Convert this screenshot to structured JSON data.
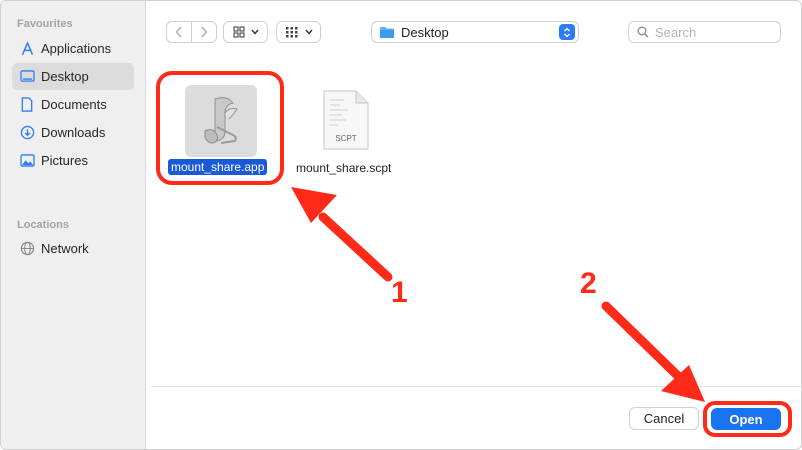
{
  "sidebar": {
    "favourites_title": "Favourites",
    "items": [
      {
        "label": "Applications",
        "icon": "applications-icon"
      },
      {
        "label": "Desktop",
        "icon": "desktop-icon"
      },
      {
        "label": "Documents",
        "icon": "documents-icon"
      },
      {
        "label": "Downloads",
        "icon": "downloads-icon"
      },
      {
        "label": "Pictures",
        "icon": "pictures-icon"
      }
    ],
    "locations_title": "Locations",
    "locations": [
      {
        "label": "Network",
        "icon": "network-icon"
      }
    ]
  },
  "toolbar": {
    "location": "Desktop",
    "search_placeholder": "Search"
  },
  "files": [
    {
      "name": "mount_share.app",
      "selected": true
    },
    {
      "name": "mount_share.scpt",
      "icon_text": "SCPT",
      "selected": false
    }
  ],
  "buttons": {
    "cancel": "Cancel",
    "open": "Open"
  },
  "annotations": {
    "step1": "1",
    "step2": "2",
    "color": "#ff2a17"
  }
}
